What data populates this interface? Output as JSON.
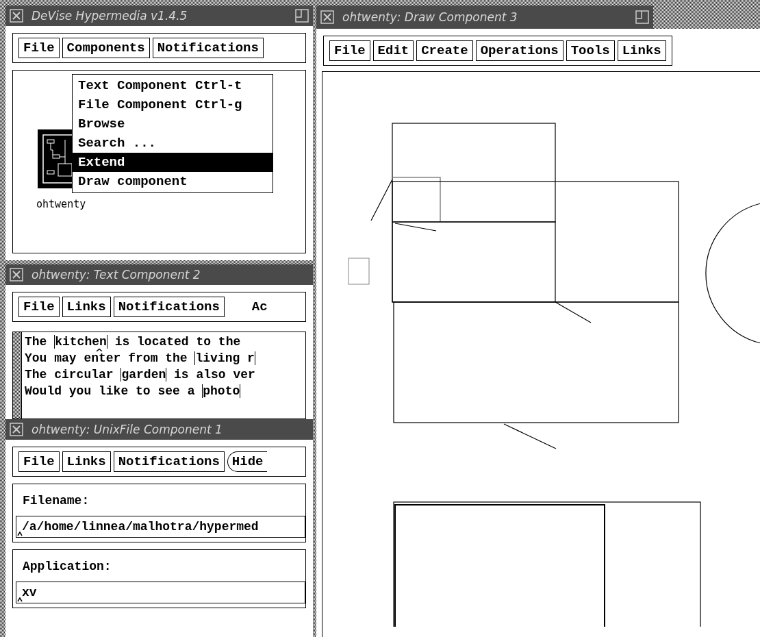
{
  "launcher": {
    "title": "DeVise Hypermedia v1.4.5",
    "menus": [
      "File",
      "Components",
      "Notifications"
    ],
    "component_label": "ohtwenty",
    "dropdown": [
      {
        "label": "Text Component Ctrl-t",
        "selected": false
      },
      {
        "label": "File Component Ctrl-g",
        "selected": false
      },
      {
        "label": "Browse",
        "selected": false
      },
      {
        "label": "Search ...",
        "selected": false
      },
      {
        "label": "Extend",
        "selected": true
      },
      {
        "label": "Draw component",
        "selected": false
      }
    ]
  },
  "text_component": {
    "title": "ohtwenty: Text Component 2",
    "menus": [
      {
        "label": "File",
        "kind": "menu"
      },
      {
        "label": "Links",
        "kind": "menu"
      },
      {
        "label": "Notifications",
        "kind": "menu"
      },
      {
        "label": "Ac",
        "kind": "label"
      }
    ],
    "lines": [
      [
        {
          "text": "The ",
          "link": false
        },
        {
          "text": "kitchen",
          "link": true
        },
        {
          "text": " is located to the",
          "link": false
        }
      ],
      [
        {
          "text": "You may enter from the ",
          "link": false
        },
        {
          "text": "living r",
          "link": true
        }
      ],
      [
        {
          "text": "The circular ",
          "link": false
        },
        {
          "text": "garden",
          "link": true
        },
        {
          "text": " is also ver",
          "link": false
        }
      ],
      [
        {
          "text": "Would you like to see a ",
          "link": false
        },
        {
          "text": "photo",
          "link": true
        }
      ]
    ]
  },
  "file_component": {
    "title": "ohtwenty: UnixFile Component 1",
    "menus": [
      {
        "label": "File",
        "kind": "menu"
      },
      {
        "label": "Links",
        "kind": "menu"
      },
      {
        "label": "Notifications",
        "kind": "menu"
      },
      {
        "label": "Hide",
        "kind": "button"
      }
    ],
    "fields": [
      {
        "label": "Filename:",
        "value": "/a/home/linnea/malhotra/hypermed"
      },
      {
        "label": "Application:",
        "value": "xv"
      }
    ]
  },
  "draw_component": {
    "title": "ohtwenty: Draw Component 3",
    "menus": [
      "File",
      "Edit",
      "Create",
      "Operations",
      "Tools",
      "Links"
    ]
  }
}
